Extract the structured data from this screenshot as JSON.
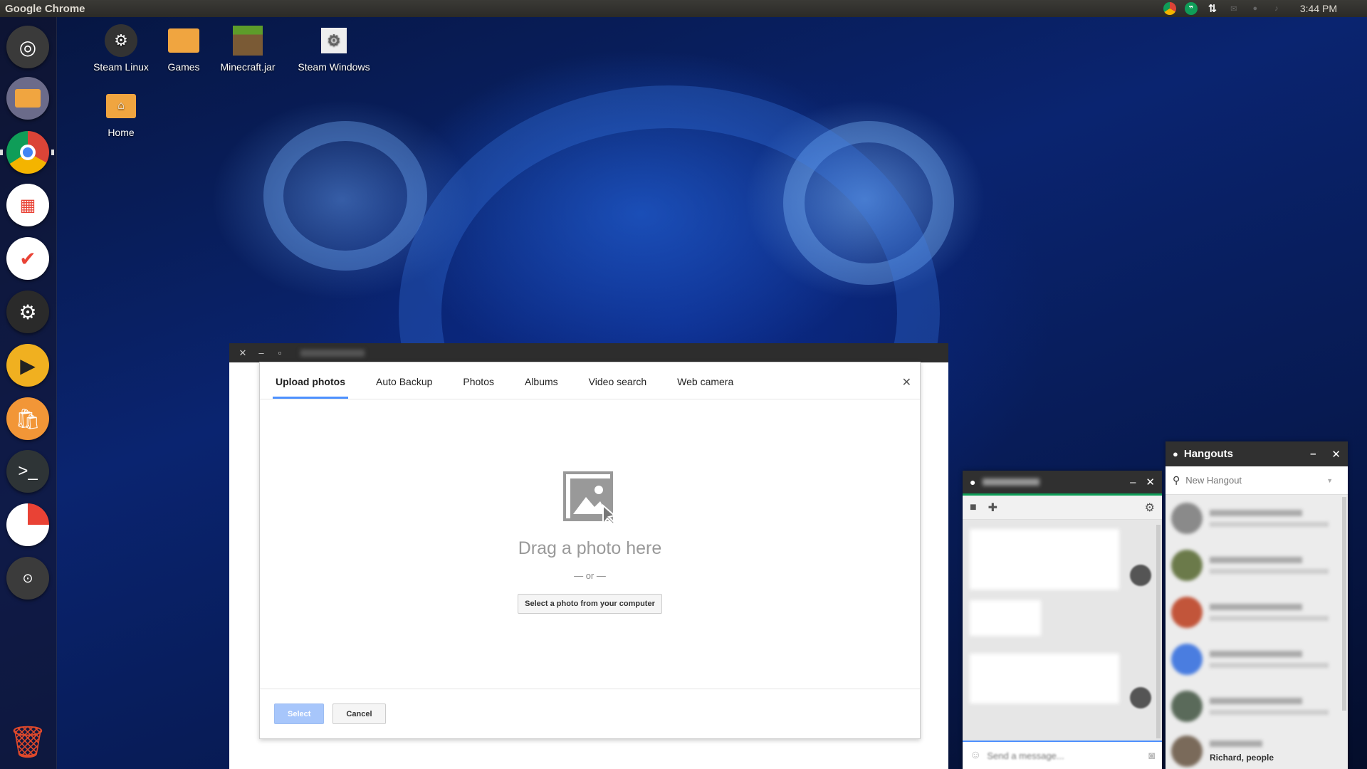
{
  "top_panel": {
    "app_name": "Google Chrome",
    "clock": "3:44 PM",
    "tray_icons": [
      "chrome-icon",
      "hangouts-icon",
      "network-icon",
      "mail-icon",
      "notification-icon",
      "volume-icon",
      "power-icon"
    ]
  },
  "launcher": {
    "items": [
      {
        "name": "ubuntu-dash-icon",
        "color": "#3a3a3a"
      },
      {
        "name": "files-icon",
        "color": "#e99a3a"
      },
      {
        "name": "chrome-icon",
        "color": "#ffffff"
      },
      {
        "name": "apps-icon",
        "color": "#ffffff"
      },
      {
        "name": "tasks-icon",
        "color": "#ffffff"
      },
      {
        "name": "steam-icon",
        "color": "#2a2a2a"
      },
      {
        "name": "player-icon",
        "color": "#f0b020"
      },
      {
        "name": "software-center-icon",
        "color": "#f29637"
      },
      {
        "name": "terminal-icon",
        "color": "#2e3436"
      },
      {
        "name": "disk-icon",
        "color": "#ffffff"
      },
      {
        "name": "toggle-settings-icon",
        "color": "#3b3b3b"
      },
      {
        "name": "trash-icon",
        "color": "#e0492b"
      }
    ]
  },
  "desktop": {
    "icons": [
      {
        "label": "Steam Linux"
      },
      {
        "label": "Games"
      },
      {
        "label": "Minecraft.jar"
      },
      {
        "label": "Steam Windows"
      },
      {
        "label": "Home"
      }
    ]
  },
  "dialog": {
    "tabs": [
      "Upload photos",
      "Auto Backup",
      "Photos",
      "Albums",
      "Video search",
      "Web camera"
    ],
    "active_tab": "Upload photos",
    "drag_text": "Drag a photo here",
    "or_text": "— or —",
    "select_from_computer": "Select a photo from your computer",
    "select_button": "Select",
    "cancel_button": "Cancel",
    "accent_color": "#4d90fe"
  },
  "chat": {
    "input_placeholder": "Send a message..."
  },
  "hangouts": {
    "title": "Hangouts",
    "search_placeholder": "New Hangout",
    "visible_contact_text": "Richard, people"
  }
}
